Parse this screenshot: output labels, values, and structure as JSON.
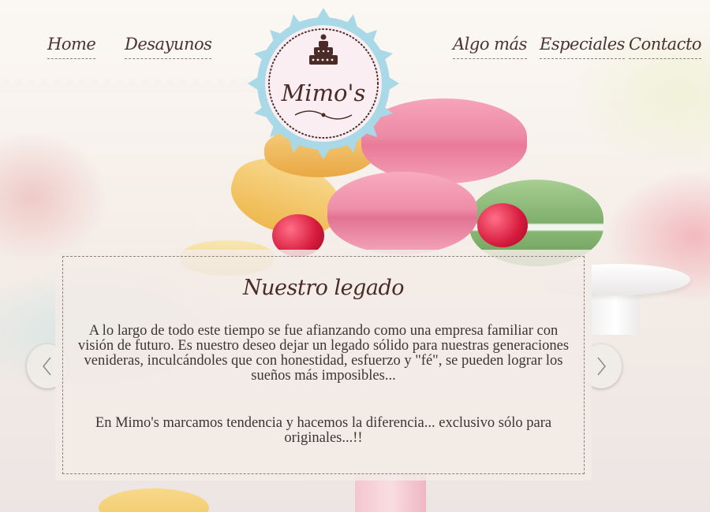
{
  "nav": {
    "home": "Home",
    "desayunos": "Desayunos",
    "algo_mas": "Algo más",
    "especiales": "Especiales",
    "contacto": "Contacto"
  },
  "logo": {
    "text": "Mimo's"
  },
  "slider": {
    "title": "Nuestro legado",
    "paragraph1": "A lo largo de todo este tiempo se fue afianzando como una empresa familiar con visión de futuro. Es nuestro deseo dejar un legado sólido para nuestras generaciones venideras, inculcándoles que con honestidad, esfuerzo y \"fé\", se pueden lograr los sueños más imposibles...",
    "paragraph2": "En Mimo's marcamos tendencia y hacemos la diferencia... exclusivo sólo para originales...!!",
    "prev_icon": "chevron-left-icon",
    "next_icon": "chevron-right-icon"
  },
  "colors": {
    "text_dark": "#4a3330",
    "logo_badge": "#a9d8e6",
    "logo_inner": "#fbeef2",
    "macaron_pink": "#f28fa8",
    "macaron_green": "#8fbf7c",
    "macaron_yellow": "#f4c770"
  }
}
